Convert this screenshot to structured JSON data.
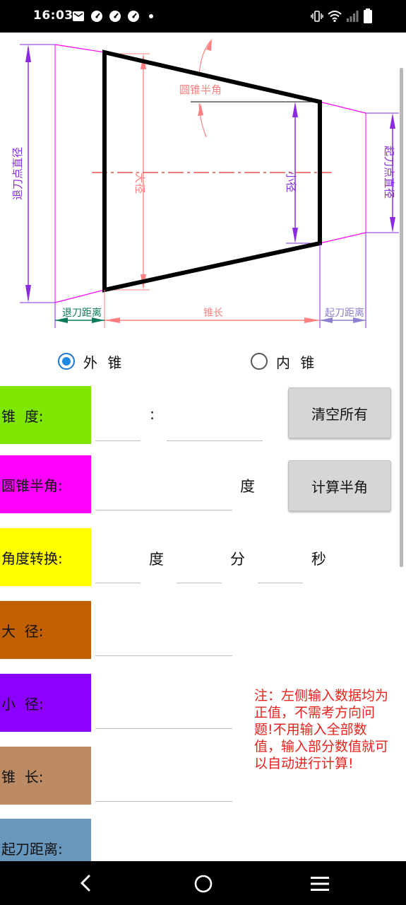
{
  "status_bar": {
    "time": "16:03"
  },
  "diagram": {
    "labels": {
      "cone_half_angle": "圆锥半角",
      "retract_point_diameter": "退刀点直径",
      "start_point_diameter": "起刀点直径",
      "large_diameter": "大径",
      "small_diameter": "小径",
      "retract_distance": "退刀距离",
      "cone_length": "锥长",
      "start_distance": "起刀距离"
    }
  },
  "cone_type": {
    "options": [
      {
        "label": "外 锥",
        "selected": true
      },
      {
        "label": "内 锥",
        "selected": false
      }
    ]
  },
  "form": {
    "taper_label": "锥  度:",
    "taper_separator": ":",
    "half_angle_label": "圆锥半角:",
    "half_angle_unit": "度",
    "angle_convert_label": "角度转换:",
    "deg_unit": "度",
    "min_unit": "分",
    "sec_unit": "秒",
    "large_diameter_label": "大  径:",
    "small_diameter_label": "小  径:",
    "cone_length_label": "锥  长:",
    "start_distance_label": "起刀距离:",
    "label_colors": [
      "#7fe600",
      "#ff00ff",
      "#ffff00",
      "#c06000",
      "#8b00ff",
      "#bc8a63",
      "#6897bd"
    ]
  },
  "buttons": {
    "clear_all": "清空所有",
    "calc_half_angle": "计算半角"
  },
  "note": "注：左侧输入数据均为正值，不需考方向问题!不用输入全部数值，输入部分数值就可以自动进行计算!"
}
